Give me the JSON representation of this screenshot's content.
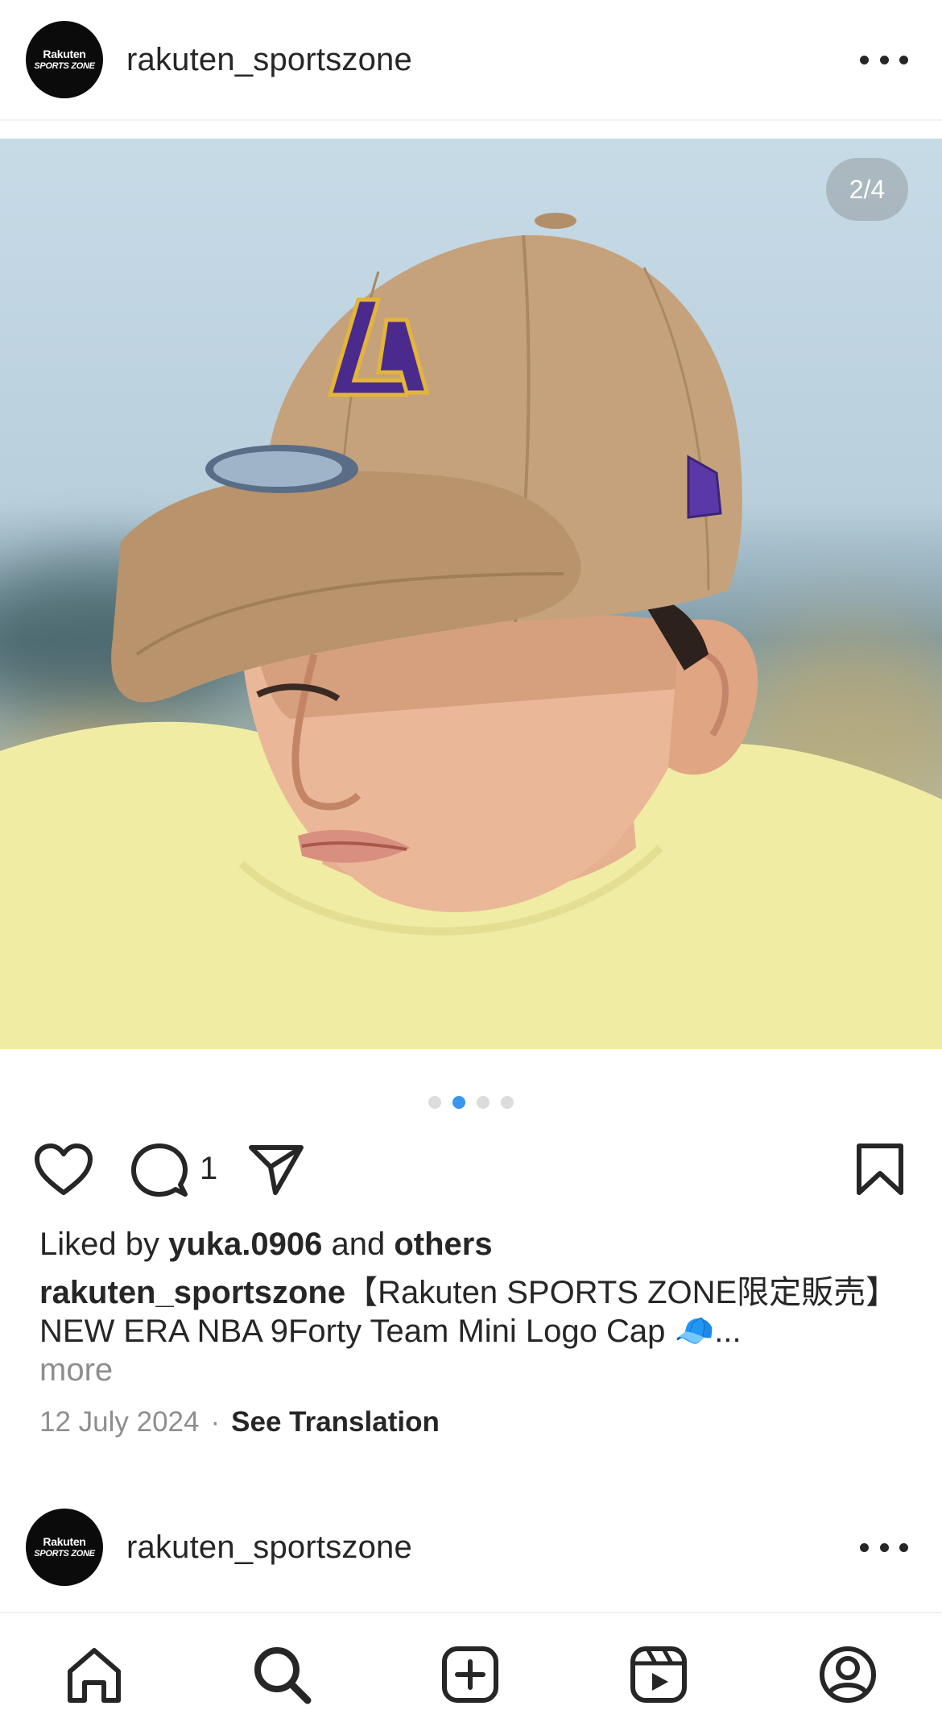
{
  "post": {
    "username": "rakuten_sportszone",
    "avatar_line1": "Rakuten",
    "avatar_line2": "SPORTS ZONE",
    "counter": "2/4",
    "carousel": {
      "total": 4,
      "active": 2
    },
    "comment_count": "1",
    "liked_by_prefix": "Liked by ",
    "liked_by_user": "yuka.0906",
    "liked_by_middle": " and ",
    "liked_by_others": "others",
    "caption_user": "rakuten_sportszone",
    "caption_text": "【Rakuten SPORTS ZONE限定販売】NEW ERA NBA 9Forty Team Mini Logo Cap 🧢...",
    "caption_more": "more",
    "date": "12 July 2024",
    "meta_sep": "·",
    "see_translation": "See Translation"
  },
  "next_post": {
    "username": "rakuten_sportszone",
    "avatar_line1": "Rakuten",
    "avatar_line2": "SPORTS ZONE"
  },
  "icons": {
    "header_more": "more-dots-icon",
    "like": "heart-icon",
    "comment": "comment-icon",
    "share": "send-icon",
    "save": "bookmark-icon",
    "tabs": [
      "home-icon",
      "search-icon",
      "create-post-icon",
      "reels-icon",
      "profile-icon"
    ]
  },
  "colors": {
    "active_dot": "#3897f0",
    "text": "#262626",
    "secondary_text": "#8e8e8e"
  }
}
